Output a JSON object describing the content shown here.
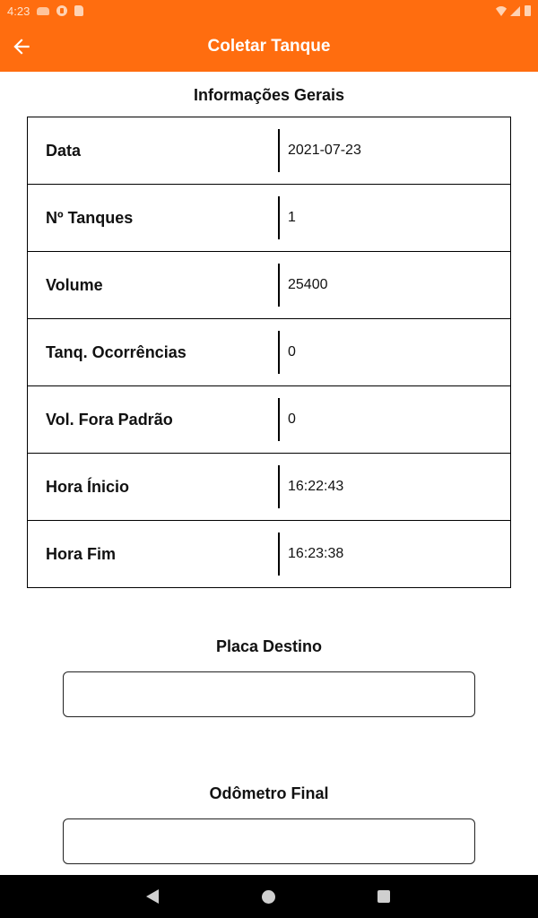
{
  "status_bar": {
    "time": "4:23"
  },
  "app_bar": {
    "title": "Coletar Tanque"
  },
  "general_info": {
    "title": "Informações Gerais",
    "rows": [
      {
        "label": "Data",
        "value": "2021-07-23"
      },
      {
        "label": "Nº Tanques",
        "value": "1"
      },
      {
        "label": "Volume",
        "value": "25400"
      },
      {
        "label": "Tanq. Ocorrências",
        "value": "0"
      },
      {
        "label": "Vol. Fora Padrão",
        "value": "0"
      },
      {
        "label": "Hora Ínicio",
        "value": "16:22:43"
      },
      {
        "label": "Hora Fim",
        "value": "16:23:38"
      }
    ]
  },
  "placa_destino": {
    "label": "Placa Destino",
    "value": ""
  },
  "odometro_final": {
    "label": "Odômetro Final",
    "value": ""
  },
  "colors": {
    "primary": "#ff6d0f",
    "nav_bar": "#000000"
  }
}
